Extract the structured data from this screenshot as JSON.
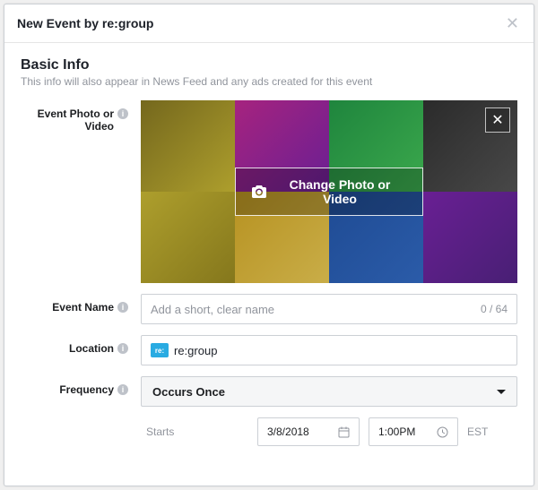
{
  "header": {
    "title": "New Event by re:group"
  },
  "section": {
    "title": "Basic Info",
    "subtitle": "This info will also appear in News Feed and any ads created for this event"
  },
  "photo": {
    "label": "Event Photo or Video",
    "change_label": "Change Photo or Video"
  },
  "eventName": {
    "label": "Event Name",
    "placeholder": "Add a short, clear name",
    "counter": "0 / 64"
  },
  "location": {
    "label": "Location",
    "token": "re:",
    "value": "re:group"
  },
  "frequency": {
    "label": "Frequency",
    "value": "Occurs Once"
  },
  "starts": {
    "label": "Starts",
    "date": "3/8/2018",
    "time": "1:00PM",
    "timezone": "EST"
  }
}
